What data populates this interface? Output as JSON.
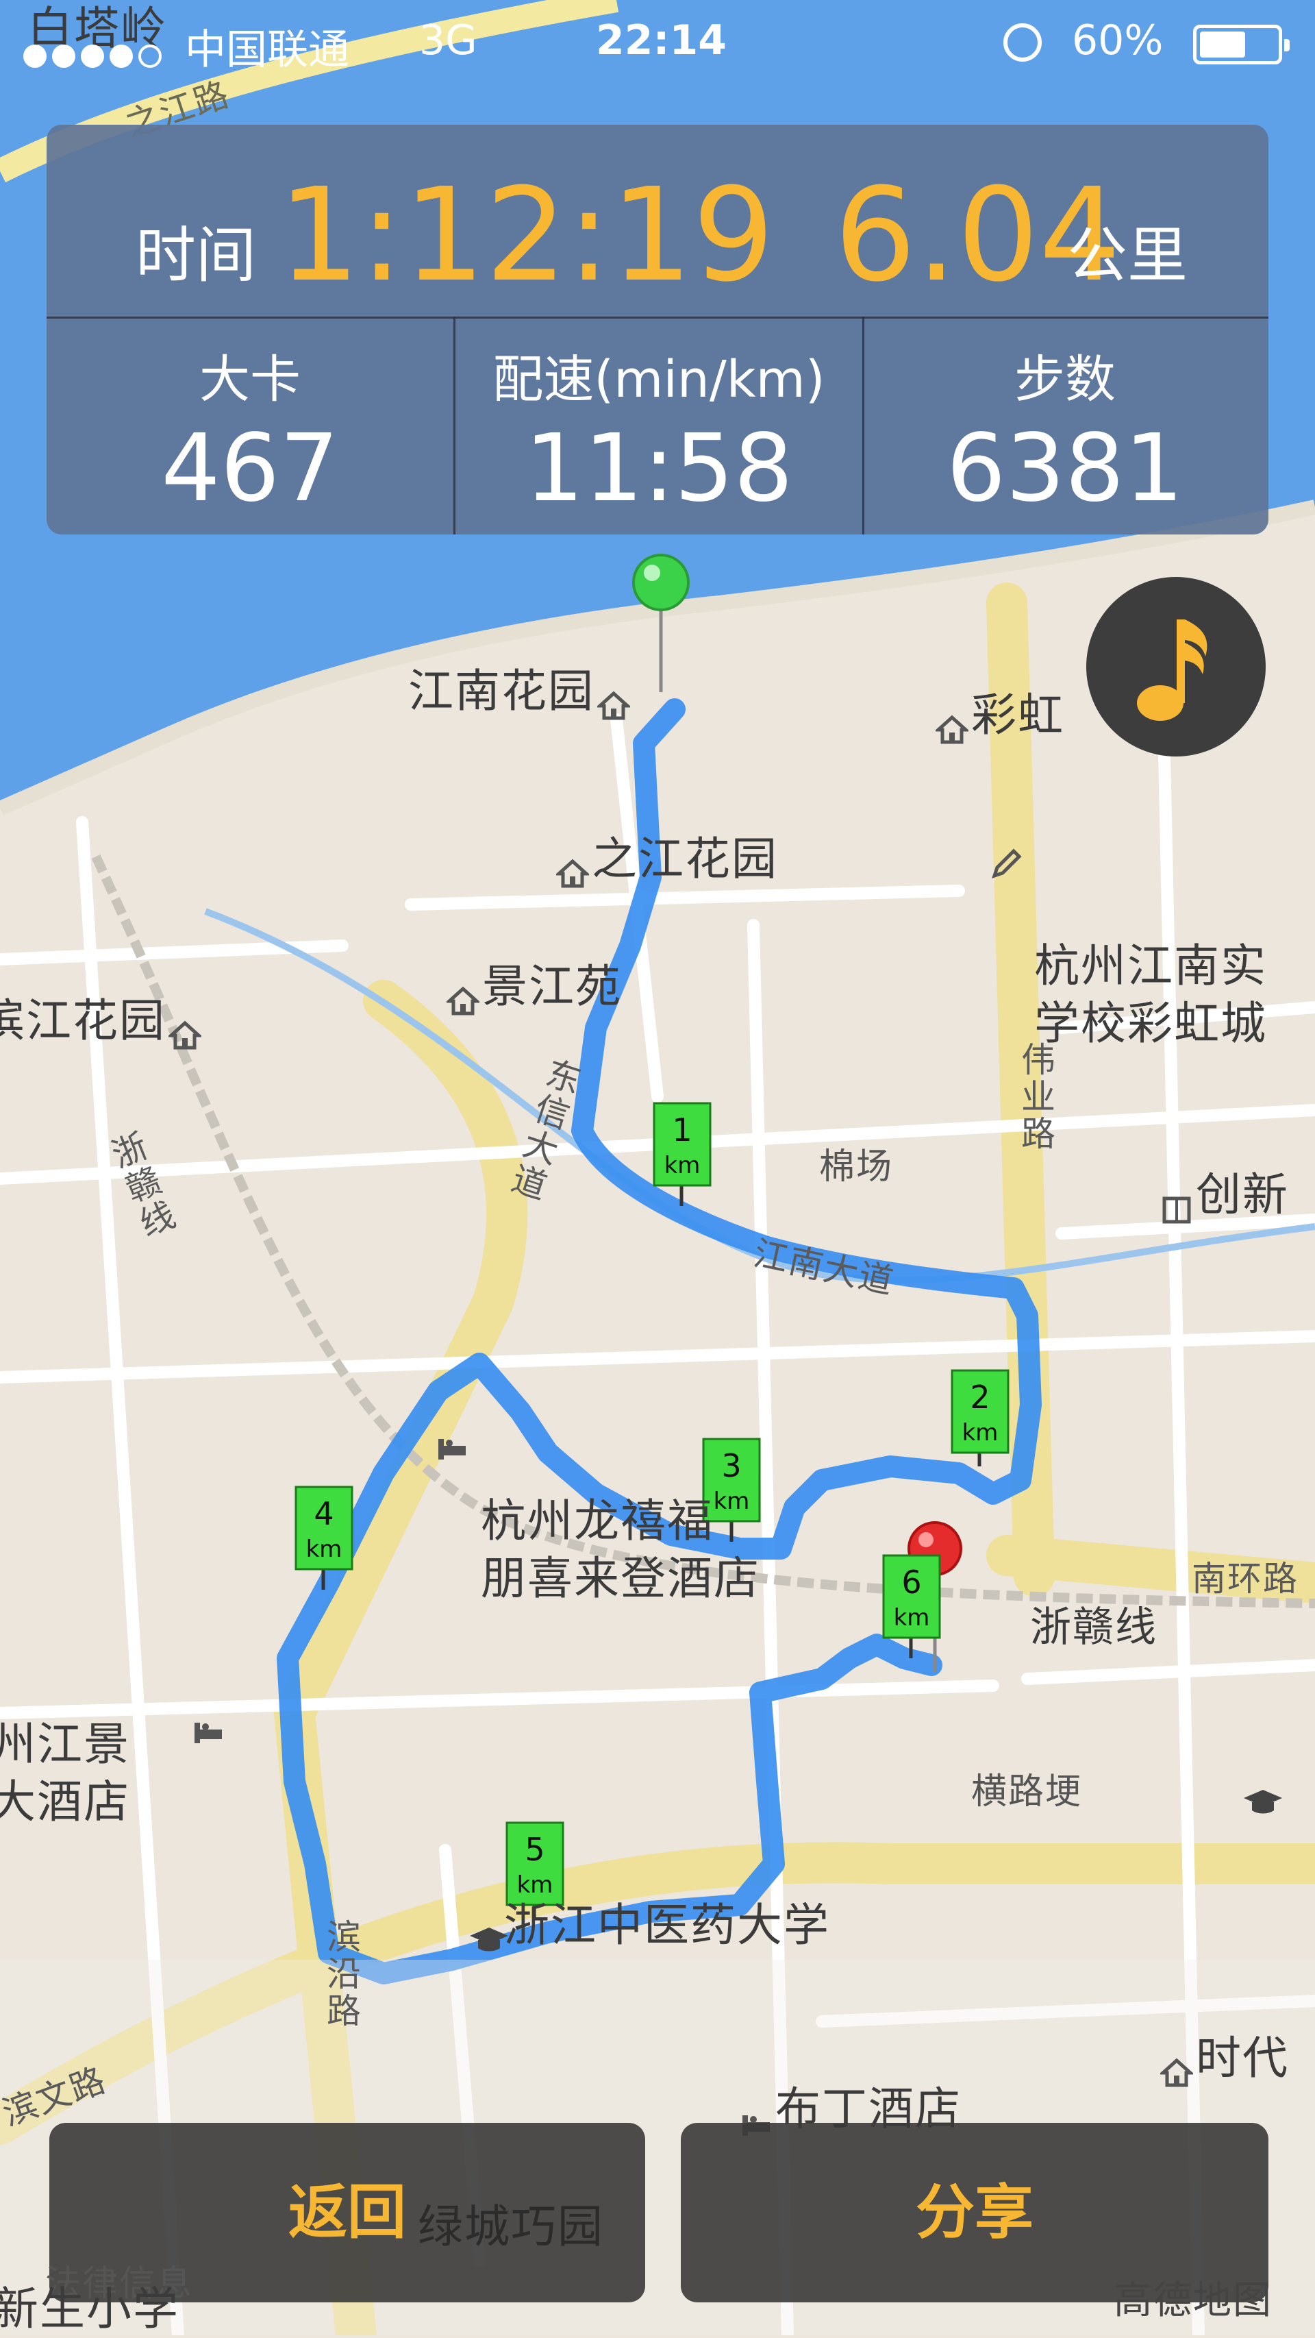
{
  "status_bar": {
    "carrier": "中国联通",
    "network": "3G",
    "time": "22:14",
    "battery_percent": "60%",
    "battery_level": 0.6
  },
  "stats": {
    "time_label": "时间",
    "time_value": "1:12:19",
    "distance_value": "6.04",
    "distance_unit": "公里",
    "calories_label": "大卡",
    "calories_value": "467",
    "pace_label": "配速(min/km)",
    "pace_value": "11:58",
    "steps_label": "步数",
    "steps_value": "6381"
  },
  "map": {
    "labels": {
      "baitaling": "白塔岭",
      "zhijiang_road": "之江路",
      "jiangnan_garden": "江南花园",
      "caihong": "彩虹",
      "zhijiang_garden": "之江花园",
      "school": "杭州江南实\n学校彩虹城",
      "jingjiangyuan": "景江苑",
      "binjiang_garden": "滨江花园",
      "dongxin_avenue": "东信大道",
      "weiye_road": "伟业路",
      "mianchang": "棉场",
      "chuangxin": "创新",
      "zhegan_line_left": "浙赣线",
      "jiangnan_avenue": "江南大道",
      "hotel_longxi": "杭州龙禧福\n朋喜来登酒店",
      "nanhuan_road": "南环路",
      "zhegan_line_right": "浙赣线",
      "hotel_jiangjing": "州江景\n大酒店",
      "henglugeng": "横路埂",
      "university": "浙江中医药大学",
      "binyan_road": "滨沿路",
      "binwen_road": "滨文路",
      "shidai": "时代",
      "budin_hotel": "布丁酒店",
      "lvcheng": "绿城巧园",
      "xinsheng_school": "新生小学",
      "falv": "法律信息"
    },
    "km_markers": [
      "1",
      "2",
      "3",
      "4",
      "5",
      "6"
    ],
    "km_unit": "km",
    "start_pin": "start-pin",
    "end_pin": "end-pin",
    "route_color": "#3a8ff0",
    "water_color": "#5fa1e8"
  },
  "buttons": {
    "back": "返回",
    "share": "分享"
  },
  "attribution": "高德地图",
  "colors": {
    "accent": "#f7b733",
    "panel": "#607496",
    "button_bg": "#3a3a3a"
  }
}
